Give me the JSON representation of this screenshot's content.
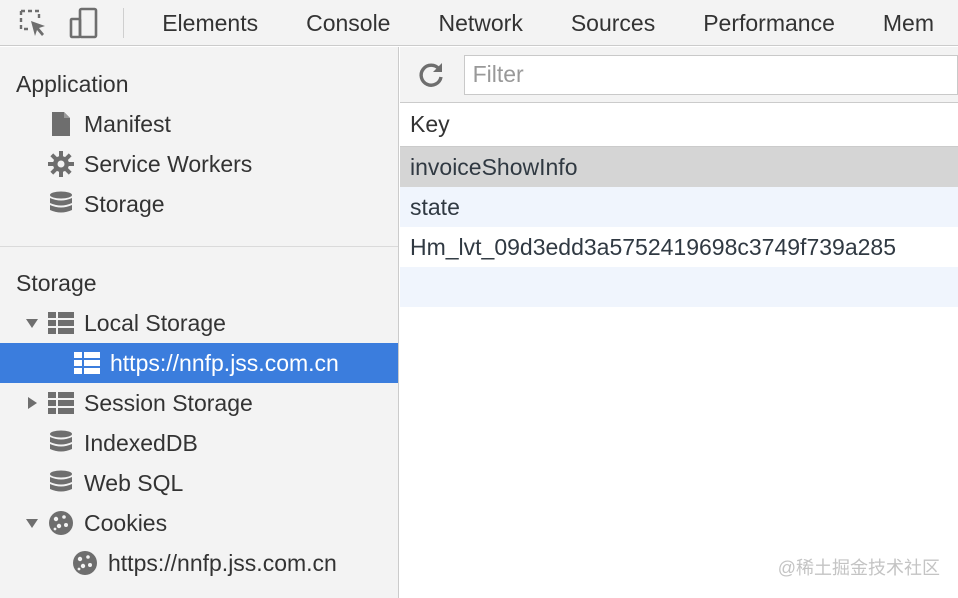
{
  "toolbar": {
    "inspect_icon": "inspect-element-icon",
    "device_icon": "device-toolbar-icon",
    "tabs": [
      "Elements",
      "Console",
      "Network",
      "Sources",
      "Performance",
      "Mem"
    ]
  },
  "sidebar": {
    "application_title": "Application",
    "application_items": [
      {
        "label": "Manifest",
        "icon": "document-icon"
      },
      {
        "label": "Service Workers",
        "icon": "gear-icon"
      },
      {
        "label": "Storage",
        "icon": "database-icon"
      }
    ],
    "storage_title": "Storage",
    "local_storage": "Local Storage",
    "local_storage_origin": "https://nnfp.jss.com.cn",
    "session_storage": "Session Storage",
    "indexeddb": "IndexedDB",
    "websql": "Web SQL",
    "cookies": "Cookies",
    "cookies_origin": "https://nnfp.jss.com.cn"
  },
  "main": {
    "filter_placeholder": "Filter",
    "column_key": "Key",
    "rows": [
      "invoiceShowInfo",
      "state",
      "Hm_lvt_09d3edd3a5752419698c3749f739a285"
    ]
  },
  "watermark": "@稀土掘金技术社区",
  "colors": {
    "selected": "#3b7ddd",
    "panel": "#f3f3f3",
    "row_selected": "#d5d5d5"
  }
}
